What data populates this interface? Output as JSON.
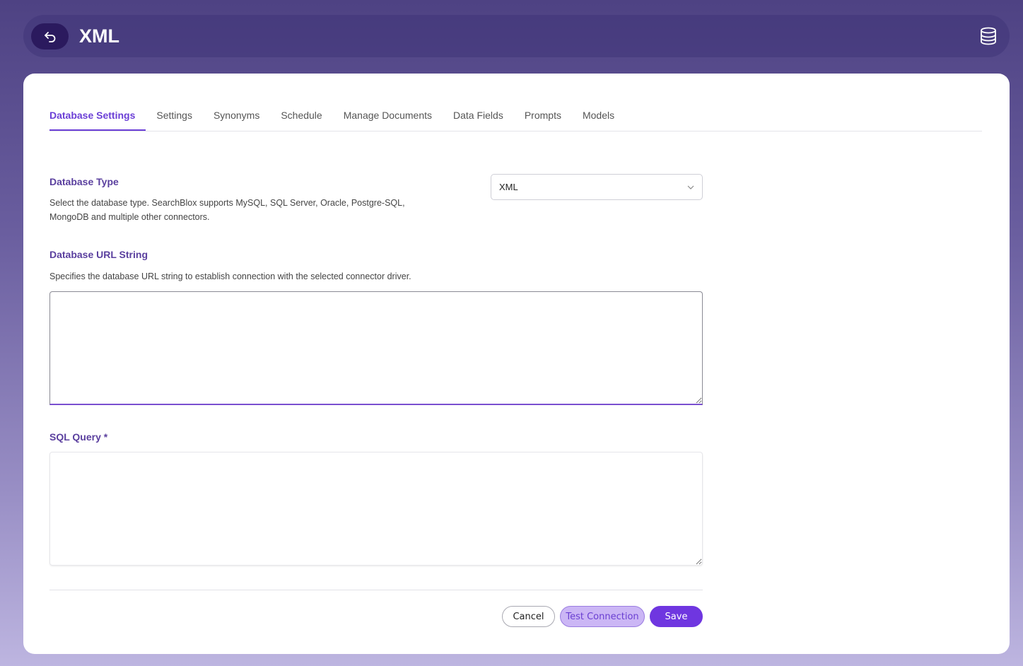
{
  "header": {
    "title": "XML",
    "back_icon": "back-arrow-icon",
    "right_icon": "database-icon"
  },
  "tabs": [
    {
      "label": "Database Settings",
      "active": true
    },
    {
      "label": "Settings"
    },
    {
      "label": "Synonyms"
    },
    {
      "label": "Schedule"
    },
    {
      "label": "Manage Documents"
    },
    {
      "label": "Data Fields"
    },
    {
      "label": "Prompts"
    },
    {
      "label": "Models"
    }
  ],
  "form": {
    "database_type": {
      "label": "Database Type",
      "description": "Select the database type. SearchBlox supports MySQL, SQL Server, Oracle, Postgre-SQL, MongoDB and multiple other connectors.",
      "selected": "XML"
    },
    "database_url": {
      "label": "Database URL String",
      "description": "Specifies the database URL string to establish connection with the selected connector driver.",
      "value": ""
    },
    "sql_query": {
      "label": "SQL Query *",
      "value": ""
    }
  },
  "actions": {
    "cancel": "Cancel",
    "test_connection": "Test Connection",
    "save": "Save"
  },
  "colors": {
    "accent": "#6f36e0",
    "label": "#5a3f9e",
    "header_dark": "#2b1a5e"
  }
}
